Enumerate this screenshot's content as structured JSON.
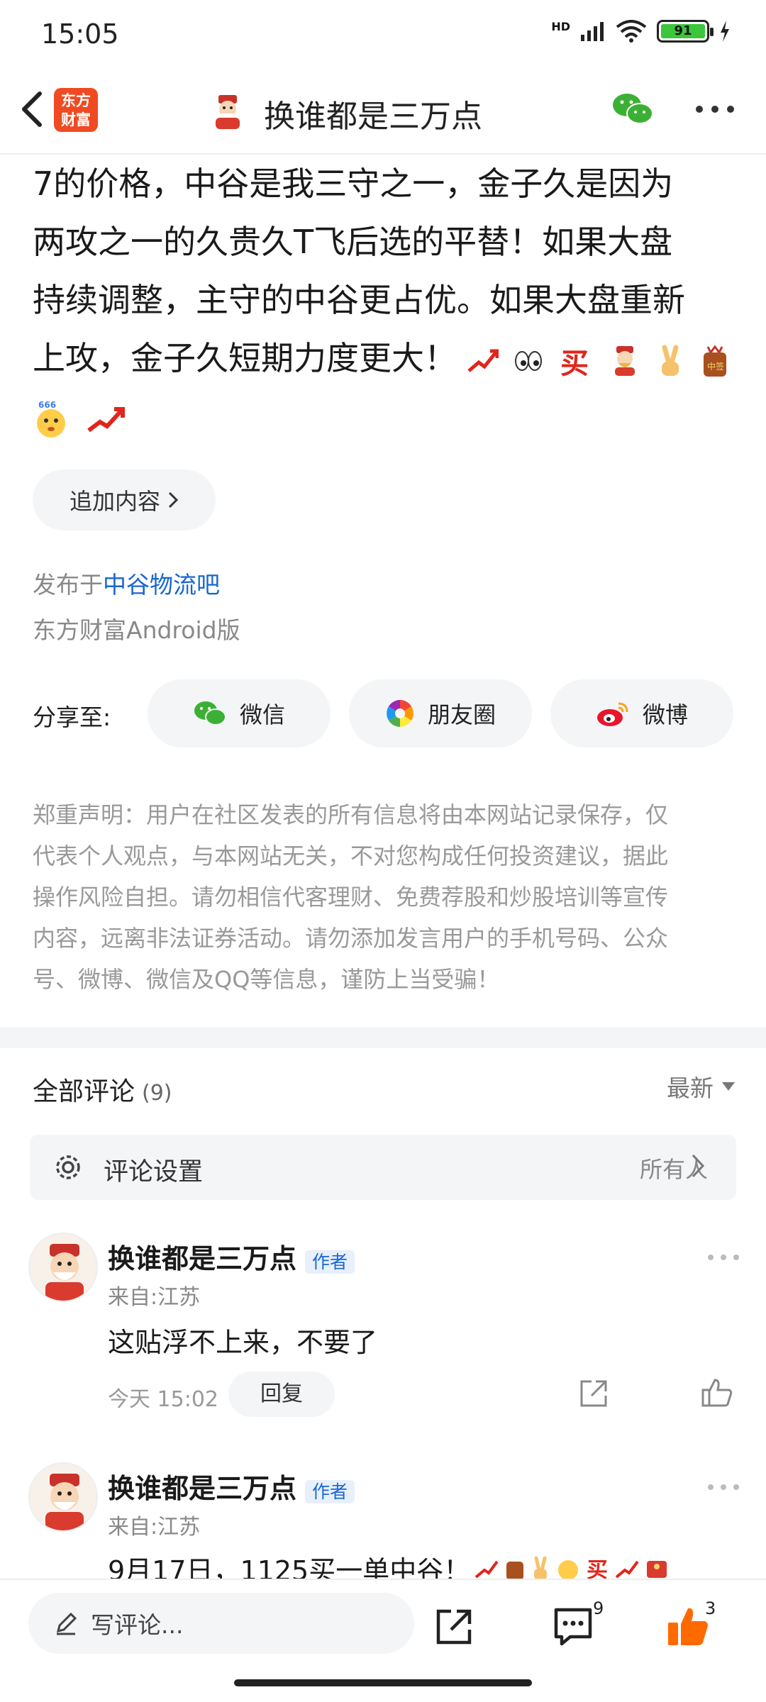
{
  "status_bar": {
    "time": "15:05",
    "network": "HD",
    "battery": "91"
  },
  "header": {
    "title": "换谁都是三万点",
    "app_logo_line1": "东方",
    "app_logo_line2": "财富"
  },
  "article": {
    "text_lines": [
      "7的价格，中谷是我三守之一，金子久是因为",
      "两攻之一的久贵久T飞后选的平替！如果大盘",
      "持续调整，主守的中谷更占优。如果大盘重新",
      "上攻，金子久短期力度更大！"
    ],
    "emoji_line1": [
      "rising-chart-icon",
      "eyes-icon",
      "buy-stamp-icon",
      "god-of-wealth-icon",
      "victory-hand-icon",
      "lucky-bag-icon"
    ],
    "emoji_line2": [
      "666-face-icon",
      "rising-chart-icon"
    ],
    "buy_char": "买",
    "lucky_char": "中签",
    "six_six_six": "666"
  },
  "add_content": "追加内容",
  "publish": {
    "prefix": "发布于",
    "forum": "中谷物流吧",
    "client": "东方财富Android版"
  },
  "share": {
    "label": "分享至:",
    "buttons": [
      {
        "label": "微信",
        "icon": "wechat-icon",
        "color": "#3cb034"
      },
      {
        "label": "朋友圈",
        "icon": "moments-icon",
        "color": "#4a90e2"
      },
      {
        "label": "微博",
        "icon": "weibo-icon",
        "color": "#e6162d"
      }
    ]
  },
  "disclaimer": [
    "郑重声明：用户在社区发表的所有信息将由本网站记录保存，仅",
    "代表个人观点，与本网站无关，不对您构成任何投资建议，据此",
    "操作风险自担。请勿相信代客理财、免费荐股和炒股培训等宣传",
    "内容，远离非法证券活动。请勿添加发言用户的手机号码、公众",
    "号、微博、微信及QQ等信息，谨防上当受骗！"
  ],
  "comments_section": {
    "title": "全部评论",
    "count": "(9)",
    "sort": "最新"
  },
  "comment_settings": {
    "label": "评论设置",
    "value": "所有人"
  },
  "comments": [
    {
      "author": "换谁都是三万点",
      "badge": "作者",
      "from": "来自:江苏",
      "text": "这贴浮不上来，不要了",
      "time": "今天 15:02",
      "reply": "回复"
    },
    {
      "author": "换谁都是三万点",
      "badge": "作者",
      "from": "来自:江苏",
      "text": "9月17日，1125买一单中谷！"
    }
  ],
  "bottom_bar": {
    "placeholder": "写评论...",
    "comment_count": "9",
    "like_count": "3"
  },
  "colors": {
    "brand": "#f04a23",
    "link": "#1967d2",
    "like": "#ff6a00"
  }
}
